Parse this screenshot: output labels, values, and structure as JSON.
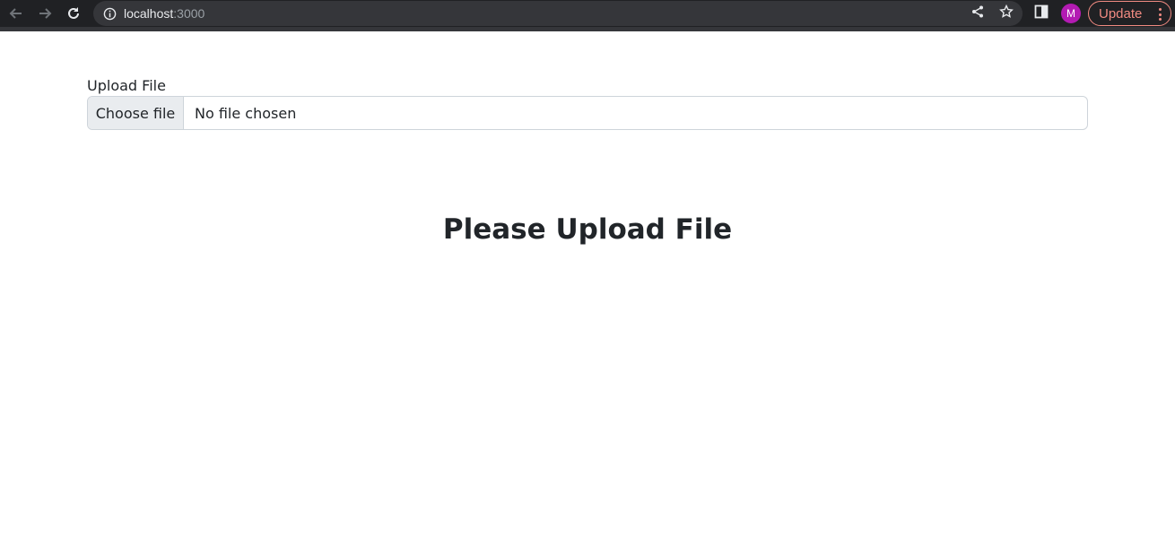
{
  "browser": {
    "url_host": "localhost",
    "url_port": ":3000",
    "profile_initial": "M",
    "update_label": "Update",
    "icons": {
      "back": "arrow-left-icon",
      "forward": "arrow-right-icon",
      "reload": "reload-icon",
      "site_info": "info-icon",
      "share": "share-icon",
      "bookmark": "star-icon",
      "side_panel": "side-panel-icon",
      "menu": "kebab-menu-icon"
    },
    "colors": {
      "toolbar_bg": "#202124",
      "omnibox_bg": "#35363a",
      "avatar_bg": "#b31bb3",
      "update_accent": "#f28b82"
    }
  },
  "page": {
    "upload_label": "Upload File",
    "choose_file_label": "Choose file",
    "file_status": "No file chosen",
    "heading": "Please Upload File"
  }
}
